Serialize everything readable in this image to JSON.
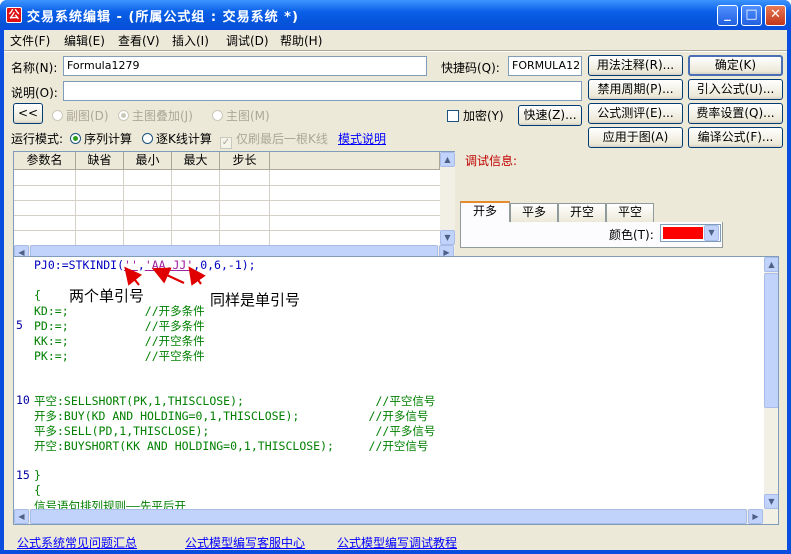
{
  "window": {
    "title": "交易系统编辑 - (所属公式组 : 交易系统 *)",
    "app_icon": "公"
  },
  "menu": [
    "文件(F)",
    "编辑(E)",
    "查看(V)",
    "插入(I)",
    "调试(D)",
    "帮助(H)"
  ],
  "form": {
    "name_label": "名称(N):",
    "name_value": "Formula1279",
    "shortcut_label": "快捷码(Q):",
    "shortcut_value": "FORMULA1279",
    "desc_label": "说明(O):",
    "desc_value": "",
    "collapse_btn": "<<",
    "radio_sub": "副图(D)",
    "radio_main_overlay": "主图叠加(J)",
    "radio_main": "主图(M)",
    "encrypt_label": "加密(Y)",
    "run_mode_label": "运行模式:",
    "run_seq": "序列计算",
    "run_bar": "逐K线计算",
    "only_last_bar": "仅刷最后一根K线",
    "mode_link": "模式说明"
  },
  "buttons": {
    "usage": "用法注释(R)...",
    "ok": "确定(K)",
    "disable_period": "禁用周期(P)...",
    "import": "引入公式(U)...",
    "quick": "快速(Z)...",
    "test": "公式测评(E)...",
    "fee": "费率设置(Q)...",
    "apply": "应用于图(A)",
    "compile": "编译公式(F)..."
  },
  "param_table": {
    "headers": [
      "参数名",
      "缺省",
      "最小",
      "最大",
      "步长"
    ]
  },
  "debug": {
    "label": "调试信息:",
    "tabs": [
      "开多",
      "平多",
      "开空",
      "平空"
    ],
    "color_label": "颜色(T):",
    "color_value": "#ff0000"
  },
  "code": {
    "lines": [
      {
        "ln": "",
        "segments": [
          [
            "PJ0:=STKINDI(",
            "c-blue"
          ],
          [
            "''",
            "c-purple"
          ],
          [
            ",",
            "c-blue"
          ],
          [
            "'AA.JJ'",
            "c-purple"
          ],
          [
            ",0,6,-1);",
            "c-blue"
          ]
        ]
      },
      {
        "ln": "",
        "segments": [
          [
            "",
            ""
          ]
        ]
      },
      {
        "ln": "",
        "segments": [
          [
            "{",
            "c-green"
          ]
        ]
      },
      {
        "ln": "",
        "segments": [
          [
            "KD:=;           //开多条件",
            "c-green"
          ]
        ]
      },
      {
        "ln": "5",
        "segments": [
          [
            "PD:=;           //平多条件",
            "c-green"
          ]
        ]
      },
      {
        "ln": "",
        "segments": [
          [
            "KK:=;           //开空条件",
            "c-green"
          ]
        ]
      },
      {
        "ln": "",
        "segments": [
          [
            "PK:=;           //平空条件",
            "c-green"
          ]
        ]
      },
      {
        "ln": "",
        "segments": [
          [
            "",
            ""
          ]
        ]
      },
      {
        "ln": "",
        "segments": [
          [
            "",
            ""
          ]
        ]
      },
      {
        "ln": "10",
        "segments": [
          [
            "平空:SELLSHORT(PK,1,THISCLOSE);                   //平空信号",
            "c-green"
          ]
        ]
      },
      {
        "ln": "",
        "segments": [
          [
            "开多:BUY(KD AND HOLDING=0,1,THISCLOSE);          //开多信号",
            "c-green"
          ]
        ]
      },
      {
        "ln": "",
        "segments": [
          [
            "平多:SELL(PD,1,THISCLOSE);                        //平多信号",
            "c-green"
          ]
        ]
      },
      {
        "ln": "",
        "segments": [
          [
            "开空:BUYSHORT(KK AND HOLDING=0,1,THISCLOSE);     //开空信号",
            "c-green"
          ]
        ]
      },
      {
        "ln": "",
        "segments": [
          [
            "",
            ""
          ]
        ]
      },
      {
        "ln": "15",
        "segments": [
          [
            "}",
            "c-green"
          ]
        ]
      },
      {
        "ln": "",
        "segments": [
          [
            "{",
            "c-green"
          ]
        ]
      },
      {
        "ln": "",
        "segments": [
          [
            "信号语句排列规则——先平后开",
            "c-green"
          ]
        ]
      }
    ]
  },
  "annotations": {
    "left": "两个单引号",
    "right": "同样是单引号"
  },
  "footer_links": [
    "公式系统常见问题汇总",
    "公式模型编写客服中心",
    "公式模型编写调试教程"
  ]
}
